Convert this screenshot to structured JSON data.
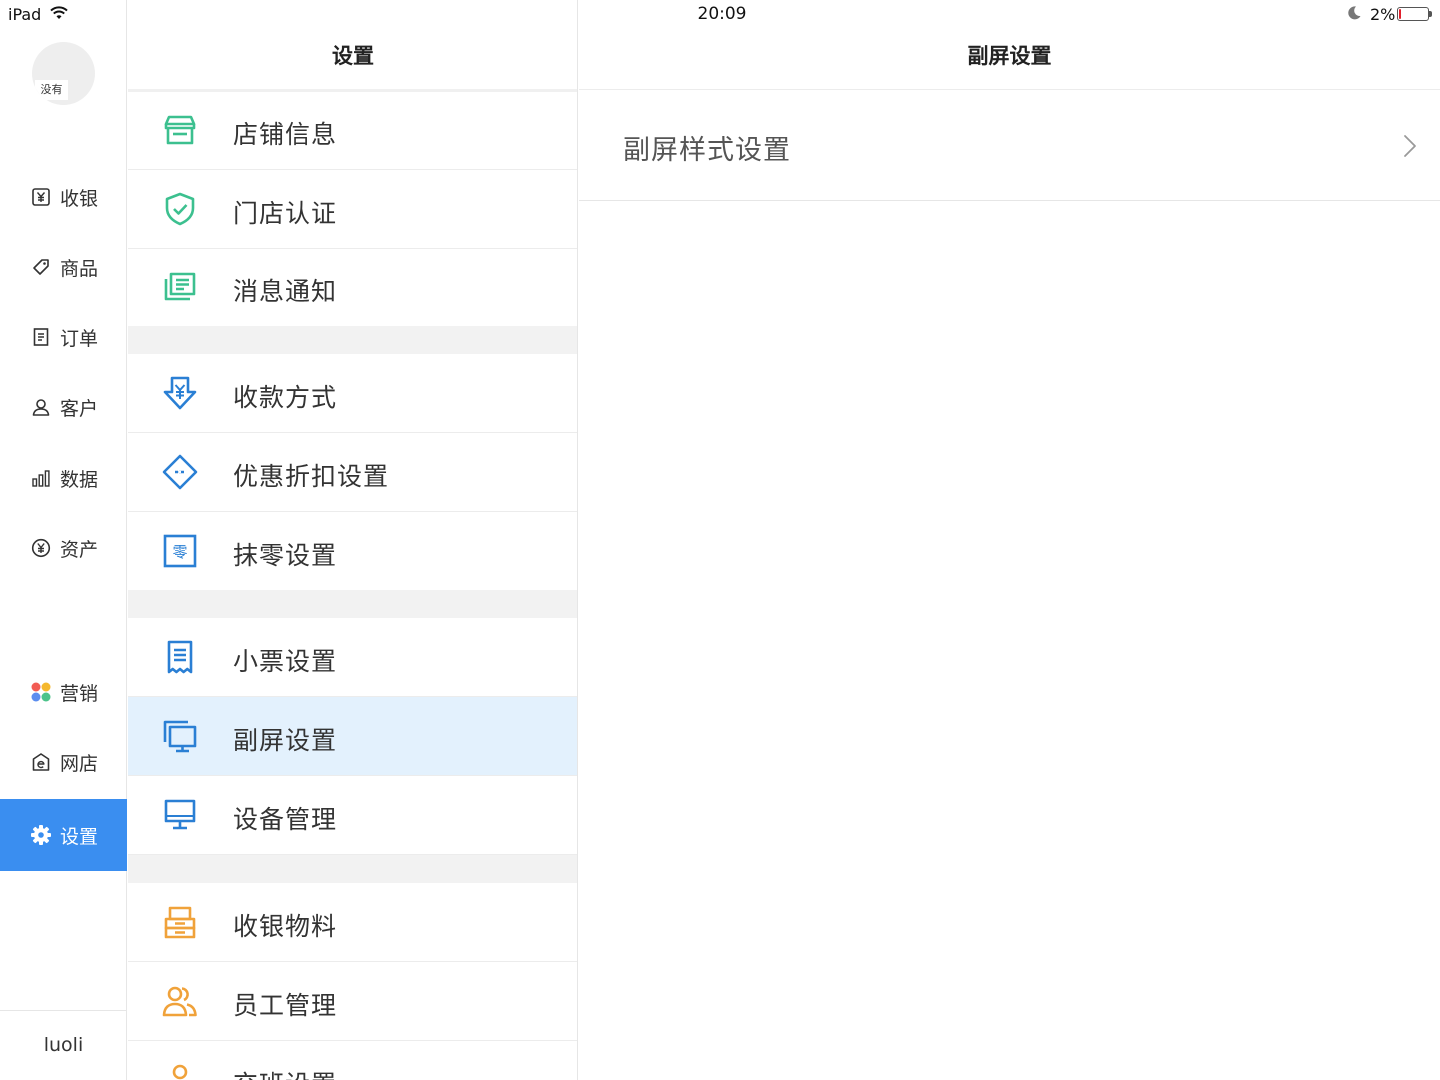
{
  "status_bar": {
    "device": "iPad",
    "time": "20:09",
    "battery_percent": "2%",
    "battery_level": 0.02
  },
  "sidebar": {
    "avatar_text": "没有",
    "items": [
      {
        "label": "收银",
        "icon": "yuan-box-icon"
      },
      {
        "label": "商品",
        "icon": "tag-icon"
      },
      {
        "label": "订单",
        "icon": "document-icon"
      },
      {
        "label": "客户",
        "icon": "person-icon"
      },
      {
        "label": "数据",
        "icon": "bar-chart-icon"
      },
      {
        "label": "资产",
        "icon": "yuan-circle-icon"
      },
      {
        "label": "营销",
        "icon": "colorful-grid-icon"
      },
      {
        "label": "网店",
        "icon": "e-shop-icon"
      },
      {
        "label": "设置",
        "icon": "gear-icon",
        "active": true
      }
    ],
    "username": "luoli"
  },
  "settings_menu": {
    "title": "设置",
    "items": [
      {
        "label": "店铺信息",
        "icon": "store-icon",
        "color": "#3cc08f"
      },
      {
        "label": "门店认证",
        "icon": "shield-check-icon",
        "color": "#3cc08f"
      },
      {
        "label": "消息通知",
        "icon": "message-icon",
        "color": "#3cc08f"
      },
      {
        "label": "收款方式",
        "icon": "yuan-arrow-icon",
        "color": "#2a7fd4"
      },
      {
        "label": "优惠折扣设置",
        "icon": "coupon-icon",
        "color": "#2a7fd4"
      },
      {
        "label": "抹零设置",
        "icon": "zero-box-icon",
        "color": "#2a7fd4",
        "icon_text": "零"
      },
      {
        "label": "小票设置",
        "icon": "receipt-icon",
        "color": "#2a7fd4"
      },
      {
        "label": "副屏设置",
        "icon": "dual-screen-icon",
        "color": "#2a7fd4",
        "selected": true
      },
      {
        "label": "设备管理",
        "icon": "monitor-icon",
        "color": "#2a7fd4"
      },
      {
        "label": "收银物料",
        "icon": "printer-box-icon",
        "color": "#f0a23a"
      },
      {
        "label": "员工管理",
        "icon": "people-icon",
        "color": "#f0a23a"
      },
      {
        "label": "交班设置",
        "icon": "person-pin-icon",
        "color": "#f0a23a"
      }
    ]
  },
  "detail": {
    "title": "副屏设置",
    "rows": [
      {
        "label": "副屏样式设置"
      }
    ]
  },
  "colors": {
    "accent": "#3a8ef0",
    "selected_row": "#e3f1fd",
    "green_icons": "#3cc08f",
    "blue_icons": "#2a7fd4",
    "orange_icons": "#f0a23a"
  }
}
